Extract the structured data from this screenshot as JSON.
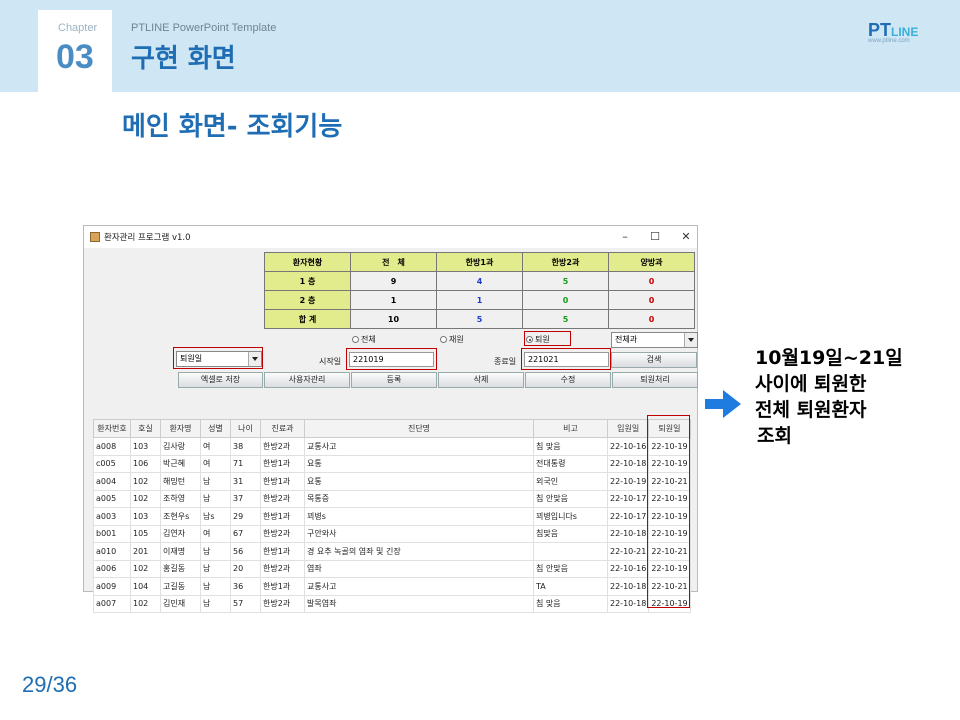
{
  "header": {
    "chapter_label": "Chapter",
    "chapter_number": "03",
    "template_name": "PTLINE PowerPoint Template",
    "title": "구현 화면",
    "logo_pt": "PT",
    "logo_line": "LINE",
    "logo_url": "www.ptline.com"
  },
  "slide_title": "메인 화면- 조회기능",
  "page_number": "29/36",
  "window": {
    "title": "환자관리 프로그램 v1.0",
    "minimize": "–",
    "maximize": "☐",
    "close": "✕"
  },
  "stats": {
    "header": [
      "환자현황",
      "전　체",
      "한방1과",
      "한방2과",
      "양방과"
    ],
    "rows": [
      {
        "label": "1 층",
        "values": [
          "9",
          "4",
          "5",
          "0"
        ]
      },
      {
        "label": "2 층",
        "values": [
          "1",
          "1",
          "0",
          "0"
        ]
      },
      {
        "label": "합 계",
        "values": [
          "10",
          "5",
          "5",
          "0"
        ]
      }
    ],
    "colors": [
      "#000000",
      "#1a3ccf",
      "#1a9a1a",
      "#cc0000"
    ]
  },
  "filters": {
    "radio_all": "전체",
    "radio_admitted": "재원",
    "radio_discharged": "퇴원",
    "dept_select": "전체과",
    "date_type_select": "퇴원일",
    "start_label": "시작일",
    "start_value": "221019",
    "end_label": "종료일",
    "end_value": "221021",
    "search_button": "검색"
  },
  "toolbar": {
    "excel": "엑셀로 저장",
    "users": "사용자관리",
    "register": "등록",
    "delete": "삭제",
    "edit": "수정",
    "discharge": "퇴원처리"
  },
  "table": {
    "columns": [
      "환자번호",
      "호실",
      "환자명",
      "성별",
      "나이",
      "진료과",
      "진단명",
      "비고",
      "입원일",
      "퇴원일"
    ],
    "rows": [
      [
        "a008",
        "103",
        "김사랑",
        "여",
        "38",
        "한방2과",
        "교통사고",
        "침 맞음",
        "22-10-16",
        "22-10-19"
      ],
      [
        "c005",
        "106",
        "박근혜",
        "여",
        "71",
        "한방1과",
        "요통",
        "전대통령",
        "22-10-18",
        "22-10-19"
      ],
      [
        "a004",
        "102",
        "해밍턴",
        "남",
        "31",
        "한방1과",
        "요통",
        "외국인",
        "22-10-19",
        "22-10-21"
      ],
      [
        "a005",
        "102",
        "조하영",
        "남",
        "37",
        "한방2과",
        "목통증",
        "침 안맞음",
        "22-10-17",
        "22-10-19"
      ],
      [
        "a003",
        "103",
        "조현우s",
        "남s",
        "29",
        "한방1과",
        "꾀병s",
        "꾀병입니다s",
        "22-10-17",
        "22-10-19"
      ],
      [
        "b001",
        "105",
        "김연자",
        "여",
        "67",
        "한방2과",
        "구안와사",
        "침맞음",
        "22-10-18",
        "22-10-19"
      ],
      [
        "a010",
        "201",
        "이재명",
        "남",
        "56",
        "한방1과",
        "경 요추 녹골의 염좌 및 긴장",
        "",
        "22-10-21",
        "22-10-21"
      ],
      [
        "a006",
        "102",
        "홍길동",
        "남",
        "20",
        "한방2과",
        "염좌",
        "침 안맞음",
        "22-10-16",
        "22-10-19"
      ],
      [
        "a009",
        "104",
        "고길동",
        "남",
        "36",
        "한방1과",
        "교통사고",
        "TA",
        "22-10-18",
        "22-10-21"
      ],
      [
        "a007",
        "102",
        "김민재",
        "남",
        "57",
        "한방2과",
        "발목염좌",
        "침 맞음",
        "22-10-18",
        "22-10-19"
      ]
    ]
  },
  "annotation": {
    "lines": [
      "10월19일~21일",
      "사이에 퇴원한",
      "전체 퇴원환자",
      " 조회"
    ],
    "arrow_color": "#1e7be0",
    "highlight_color": "#c00000"
  }
}
